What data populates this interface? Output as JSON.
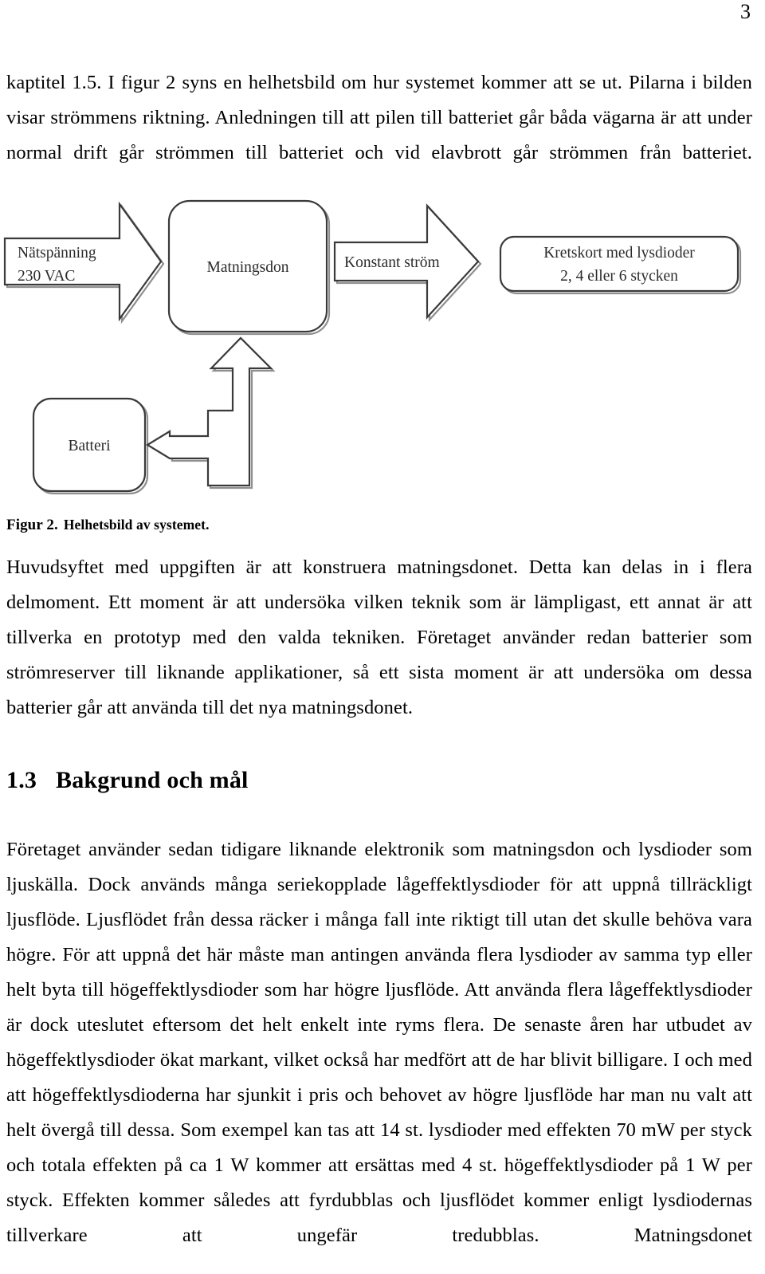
{
  "page": {
    "number": "3"
  },
  "paragraphs": {
    "top": "kaptitel 1.5. I figur 2 syns en helhetsbild om hur systemet kommer att se ut. Pilarna i bilden visar strömmens riktning. Anledningen till att pilen till batteriet går båda vägarna är att under normal drift går strömmen till batteriet och vid elavbrott går strömmen från batteriet.",
    "after_figure": "Huvudsyftet med uppgiften är att konstruera matningsdonet. Detta kan delas in i flera delmoment. Ett moment är att undersöka vilken teknik som är lämpligast, ett annat är att tillverka en prototyp med den valda tekniken. Företaget använder redan batterier som strömreserver till liknande applikationer, så ett sista moment är att undersöka om dessa batterier går att använda till det nya matningsdonet.",
    "background": "Företaget använder sedan tidigare liknande elektronik som matningsdon och lysdioder som ljuskälla. Dock används många seriekopplade lågeffektlysdioder för att uppnå tillräckligt ljusflöde. Ljusflödet från dessa räcker i många fall inte riktigt till utan det skulle behöva vara högre. För att uppnå det här måste man antingen använda flera lysdioder av samma typ eller helt byta till högeffektlysdioder som har högre ljusflöde. Att använda flera lågeffektlysdioder är dock uteslutet eftersom det helt enkelt inte ryms flera. De senaste åren har utbudet av högeffektlysdioder ökat markant, vilket också har medfört att de har blivit billigare. I och med att högeffektlysdioderna har sjunkit i pris och behovet av högre ljusflöde har man nu valt att helt övergå till dessa. Som exempel kan tas att 14 st. lysdioder med effekten 70 mW per styck och totala effekten på ca 1 W kommer att ersättas med 4 st. högeffektlysdioder på 1 W per styck. Effekten kommer således att fyrdubblas och ljusflödet kommer enligt lysdiodernas tillverkare att ungefär tredubblas. Matningsdonet"
  },
  "figure": {
    "caption_label": "Figur 2.",
    "caption_text": "Helhetsbild av systemet.",
    "nodes": {
      "mains_line1": "Nätspänning",
      "mains_line2": "230 VAC",
      "power_supply": "Matningsdon",
      "constant_current": "Konstant ström",
      "pcb_line1": "Kretskort med lysdioder",
      "pcb_line2": "2, 4 eller 6 stycken",
      "battery": "Batteri"
    }
  },
  "heading": {
    "number": "1.3",
    "title": "Bakgrund och mål"
  },
  "colors": {
    "text": "#000000",
    "diagram_stroke": "#3a3a3a",
    "diagram_shadow": "#8a8a8a",
    "diagram_label": "#2b2b2b",
    "background": "#ffffff"
  }
}
